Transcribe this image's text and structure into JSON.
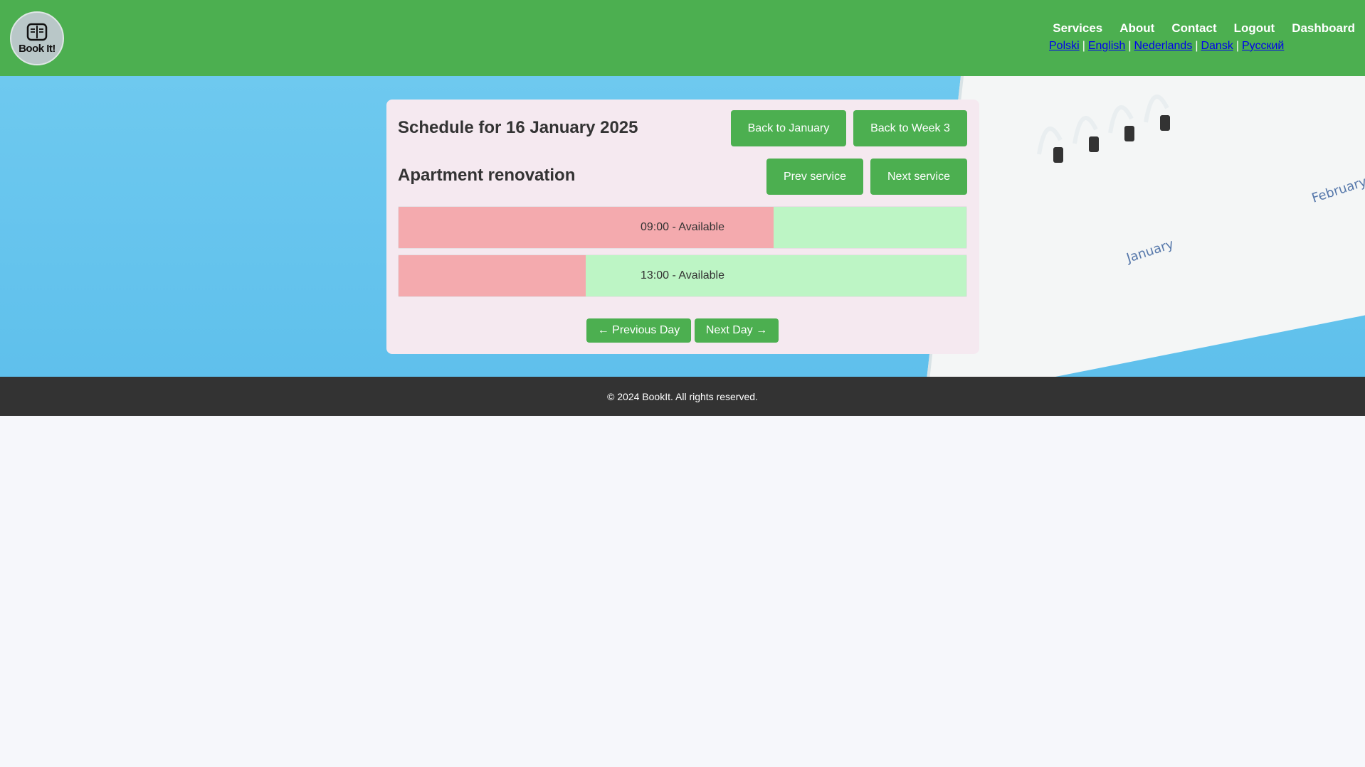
{
  "header": {
    "logo_text": "Book It!",
    "nav": [
      "Services",
      "About",
      "Contact",
      "Logout",
      "Dashboard"
    ],
    "languages": [
      "Polski",
      "English",
      "Nederlands",
      "Dansk",
      "Русский"
    ]
  },
  "schedule": {
    "title": "Schedule for 16 January 2025",
    "back_month": "Back to January",
    "back_week": "Back to Week 3",
    "service_name": "Apartment renovation",
    "prev_service": "Prev service",
    "next_service": "Next service",
    "slots": [
      {
        "label": "09:00 - Available",
        "booked_fraction": 0.66
      },
      {
        "label": "13:00 - Available",
        "booked_fraction": 0.33
      }
    ],
    "prev_day": "← Previous Day",
    "next_day": "Next Day →"
  },
  "background": {
    "month1": "January",
    "month2": "February"
  },
  "footer": {
    "copyright": "© 2024 BookIt. All rights reserved."
  },
  "colors": {
    "brand_green": "#4caf50",
    "busy": "#f4aaae",
    "free": "#bdf5c5",
    "footer": "#333333"
  }
}
